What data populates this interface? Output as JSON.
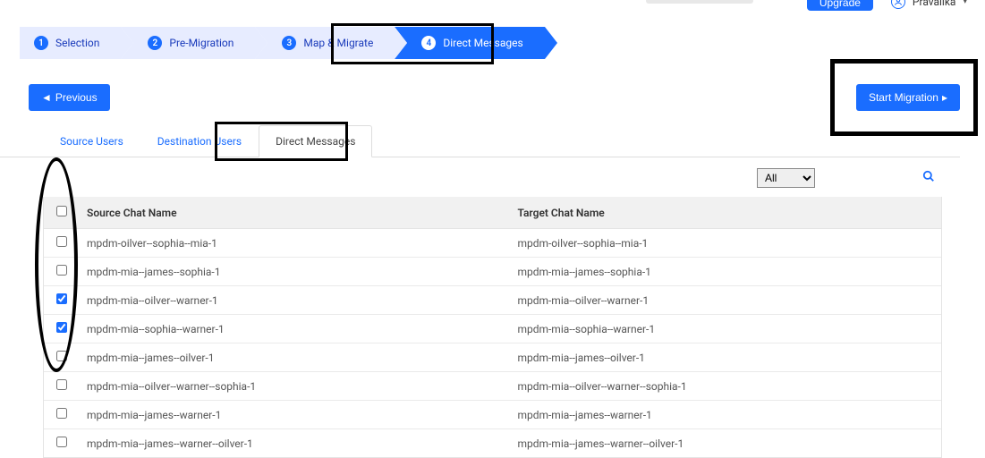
{
  "header": {
    "upgrade_label": "Upgrade",
    "user_name": "Pravalika"
  },
  "steps": [
    {
      "num": "1",
      "label": "Selection"
    },
    {
      "num": "2",
      "label": "Pre-Migration"
    },
    {
      "num": "3",
      "label": "Map & Migrate"
    },
    {
      "num": "4",
      "label": "Direct Messages"
    }
  ],
  "buttons": {
    "previous": "Previous",
    "start_migration": "Start Migration"
  },
  "tabs": [
    {
      "label": "Source Users"
    },
    {
      "label": "Destination Users"
    },
    {
      "label": "Direct Messages"
    }
  ],
  "filter": {
    "selected": "All"
  },
  "table": {
    "headers": {
      "source": "Source Chat Name",
      "target": "Target Chat Name"
    },
    "rows": [
      {
        "checked": false,
        "source": "mpdm-oilver--sophia--mia-1",
        "target": "mpdm-oilver--sophia--mia-1"
      },
      {
        "checked": false,
        "source": "mpdm-mia--james--sophia-1",
        "target": "mpdm-mia--james--sophia-1"
      },
      {
        "checked": true,
        "source": "mpdm-mia--oilver--warner-1",
        "target": "mpdm-mia--oilver--warner-1"
      },
      {
        "checked": true,
        "source": "mpdm-mia--sophia--warner-1",
        "target": "mpdm-mia--sophia--warner-1"
      },
      {
        "checked": false,
        "source": "mpdm-mia--james--oilver-1",
        "target": "mpdm-mia--james--oilver-1"
      },
      {
        "checked": false,
        "source": "mpdm-mia--oilver--warner--sophia-1",
        "target": "mpdm-mia--oilver--warner--sophia-1"
      },
      {
        "checked": false,
        "source": "mpdm-mia--james--warner-1",
        "target": "mpdm-mia--james--warner-1"
      },
      {
        "checked": false,
        "source": "mpdm-mia--james--warner--oilver-1",
        "target": "mpdm-mia--james--warner--oilver-1"
      }
    ]
  }
}
